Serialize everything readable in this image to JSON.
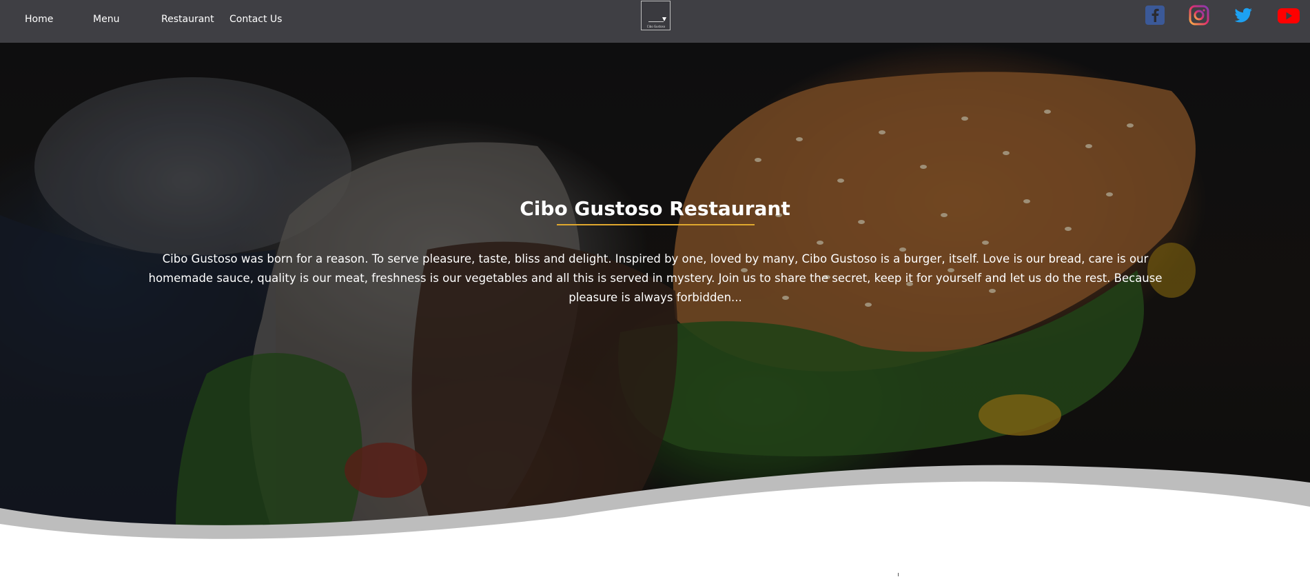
{
  "nav": {
    "items": [
      {
        "label": "Home"
      },
      {
        "label": "Menu"
      },
      {
        "label": "Restaurant"
      },
      {
        "label": "Contact Us"
      }
    ]
  },
  "logo": {
    "text": "Cibo Gustoso"
  },
  "social": {
    "icons": [
      "facebook-icon",
      "instagram-icon",
      "twitter-icon",
      "youtube-icon"
    ],
    "colors": {
      "facebook": "#3b5998",
      "instagram": "#d6249f",
      "twitter": "#1da1f2",
      "youtube": "#ff0000"
    }
  },
  "hero": {
    "title": "Cibo Gustoso Restaurant",
    "description": "Cibo Gustoso was born for a reason. To serve pleasure, taste, bliss and delight. Inspired by one, loved by many, Cibo Gustoso is a burger, itself. Love is our bread, care is our homemade sauce, quality is our meat, freshness is our vegetables and all this is served in mystery. Join us to share the secret, keep it for yourself and let us do the rest. Because pleasure is always forbidden..."
  },
  "colors": {
    "header": "#3f3f44",
    "accent_underline": "#e0a82e",
    "text": "#ffffff"
  }
}
